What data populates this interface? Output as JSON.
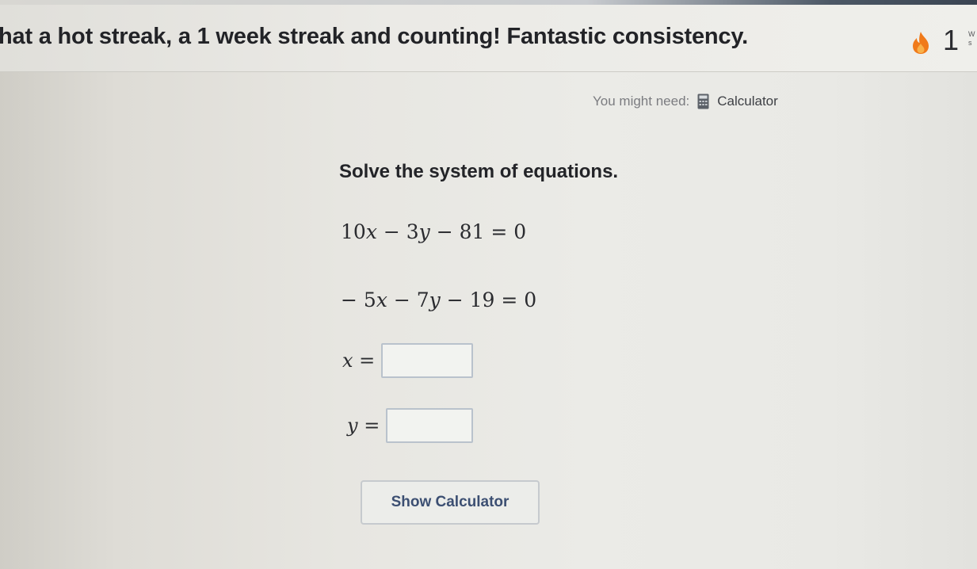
{
  "banner": {
    "message": "hat a hot streak, a 1 week streak and counting! Fantastic consistency.",
    "streak_count": "1",
    "streak_sub": "W\ns",
    "icon": "flame-icon"
  },
  "tools": {
    "prompt": "You might need:",
    "calculator_icon": "calculator-icon",
    "calculator_label": "Calculator"
  },
  "problem": {
    "question": "Solve the system of equations.",
    "equation_1": {
      "coef_x": "10",
      "var_x": "x",
      "op1": " − ",
      "coef_y": "3",
      "var_y": "y",
      "op2": " − ",
      "constant": "81",
      "rhs": " = 0"
    },
    "equation_2": {
      "lead": "− ",
      "coef_x": "5",
      "var_x": "x",
      "op1": " − ",
      "coef_y": "7",
      "var_y": "y",
      "op2": " − ",
      "constant": "19",
      "rhs": " = 0"
    },
    "answer_x_label": "x =",
    "answer_x_value": "",
    "answer_y_label": "y =",
    "answer_y_value": ""
  },
  "actions": {
    "show_calculator": "Show Calculator"
  },
  "colors": {
    "flame": "#f07a1a",
    "button_text": "#3c4f72",
    "input_border": "#b9c2cc"
  }
}
